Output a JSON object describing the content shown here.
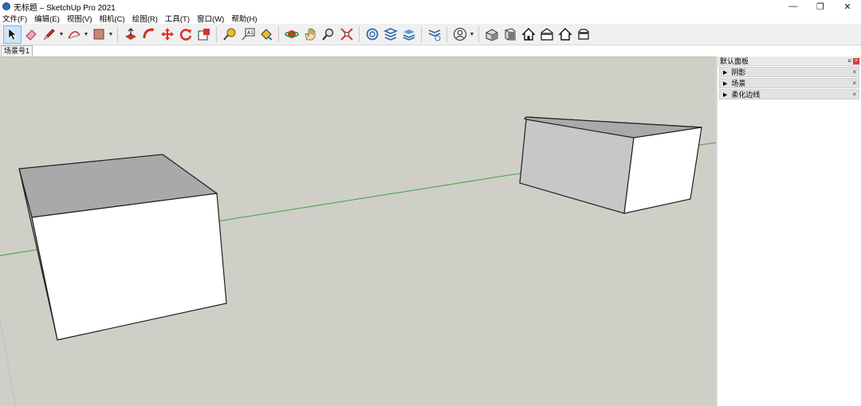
{
  "window": {
    "title": "无标题 – SketchUp Pro 2021",
    "minimize_glyph": "—",
    "restore_glyph": "❐",
    "close_glyph": "✕"
  },
  "menu": [
    "文件(F)",
    "编辑(E)",
    "视图(V)",
    "相机(C)",
    "绘图(R)",
    "工具(T)",
    "窗口(W)",
    "帮助(H)"
  ],
  "toolbar": {
    "icons": [
      "select-icon",
      "eraser-icon",
      "pencil-icon",
      "arc-icon",
      "rectangle-icon",
      "push-pull-icon",
      "follow-me-icon",
      "move-icon",
      "rotate-icon",
      "scale-icon",
      "tape-measure-icon",
      "text-icon",
      "paint-bucket-icon",
      "orbit-icon",
      "pan-icon",
      "zoom-icon",
      "zoom-extents-icon",
      "warehouse-icon",
      "extension-warehouse-icon",
      "layout-icon",
      "extension-manager-icon",
      "account-icon",
      "iso-view-icon",
      "front-view-icon",
      "home-view-icon",
      "house-view-icon",
      "right-view-icon",
      "back-view-icon"
    ]
  },
  "scene_tab": "场景号1",
  "panel": {
    "title": "默认面板",
    "pin_glyph": "¤",
    "close_glyph": "×",
    "trays": [
      {
        "label": "阴影",
        "close_glyph": "×"
      },
      {
        "label": "场景",
        "close_glyph": "×"
      },
      {
        "label": "柔化边线",
        "close_glyph": "×"
      }
    ]
  },
  "colors": {
    "background": "#cfcfc8",
    "face_front": "#ffffff",
    "face_top": "#a9a9a9",
    "face_side": "#c7c7c7",
    "axis_green": "#3fa33f",
    "edge": "#202020"
  }
}
